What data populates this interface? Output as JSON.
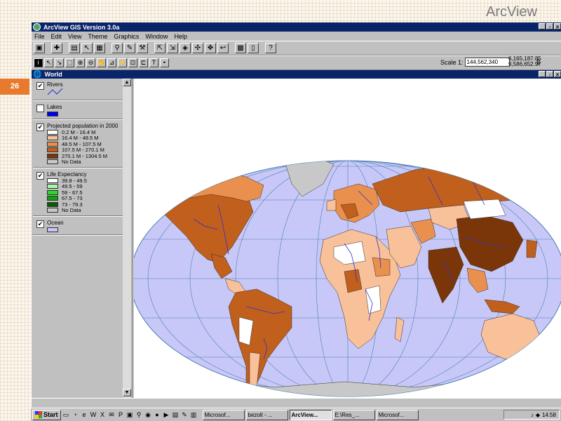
{
  "slide": {
    "title": "ArcView",
    "number": "26"
  },
  "app": {
    "title": "ArcView GIS Version 3.0a",
    "window_buttons": [
      "_",
      "▫",
      "×"
    ],
    "menu": [
      "File",
      "Edit",
      "View",
      "Theme",
      "Graphics",
      "Window",
      "Help"
    ],
    "scale_label": "Scale 1:",
    "scale_value": "144,562,340",
    "coord_x": "6,165,187.85",
    "coord_y": "9,586,652.97"
  },
  "view": {
    "title": "World",
    "themes": [
      {
        "name": "Rivers",
        "checked": true
      },
      {
        "name": "Lakes",
        "checked": false
      },
      {
        "name": "Projected population in 2000",
        "checked": true,
        "classes": [
          {
            "label": "0.2 M - 16.4 M",
            "color": "#ffffff"
          },
          {
            "label": "16.4 M - 48.5 M",
            "color": "#f9c19a"
          },
          {
            "label": "48.5 M - 107.5 M",
            "color": "#e9904e"
          },
          {
            "label": "107.5 M - 270.1 M",
            "color": "#c15f1d"
          },
          {
            "label": "270.1 M - 1304.5 M",
            "color": "#7a3608"
          },
          {
            "label": "No Data",
            "color": "#c8c8c8"
          }
        ]
      },
      {
        "name": "Life Expectancy",
        "checked": true,
        "classes": [
          {
            "label": "39.8 - 49.5",
            "color": "#ffffff"
          },
          {
            "label": "49.5 - 59",
            "color": "#aaf5aa"
          },
          {
            "label": "59 - 67.5",
            "color": "#22dd22"
          },
          {
            "label": "67.5 - 73",
            "color": "#10a010"
          },
          {
            "label": "73 - 79.3",
            "color": "#0a5a0a"
          },
          {
            "label": "No Data",
            "color": "#c8c8c8"
          }
        ]
      },
      {
        "name": "Ocean",
        "checked": true,
        "color": "#c7c7f7"
      }
    ],
    "colors": {
      "ocean": "#c8c8f8",
      "rivers": "#3030d0",
      "lakes": "#0000ee",
      "graticule": "#4a80b0",
      "nodata": "#c8c8c8"
    }
  },
  "taskbar": {
    "start": "Start",
    "tasks": [
      "Microsof...",
      "bezolt - ...",
      "ArcView...",
      "E:\\Res_...",
      "Microsof..."
    ],
    "active_task": 2,
    "clock": "14:58"
  }
}
